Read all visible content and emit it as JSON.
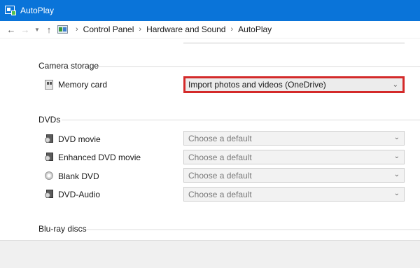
{
  "window": {
    "title": "AutoPlay"
  },
  "address": {
    "back_icon": "arrow-left-icon",
    "forward_icon": "arrow-right-icon",
    "recent_icon": "chevron-down-icon",
    "up_icon": "arrow-up-icon",
    "breadcrumbs": [
      "Control Panel",
      "Hardware and Sound",
      "AutoPlay"
    ]
  },
  "groups": [
    {
      "header": "Camera storage",
      "rows": [
        {
          "label": "Memory card",
          "icon": "memory-card-icon",
          "value": "Import photos and videos (OneDrive)"
        }
      ]
    },
    {
      "header": "DVDs",
      "rows": [
        {
          "label": "DVD movie",
          "icon": "dvd-movie-icon",
          "value": "Choose a default"
        },
        {
          "label": "Enhanced DVD movie",
          "icon": "dvd-movie-icon",
          "value": "Choose a default"
        },
        {
          "label": "Blank DVD",
          "icon": "blank-disc-icon",
          "value": "Choose a default"
        },
        {
          "label": "DVD-Audio",
          "icon": "dvd-audio-icon",
          "value": "Choose a default"
        }
      ]
    },
    {
      "header": "Blu-ray discs",
      "rows": []
    }
  ],
  "colors": {
    "titlebar": "#0a74d9",
    "highlight_border": "#d42a2a"
  }
}
